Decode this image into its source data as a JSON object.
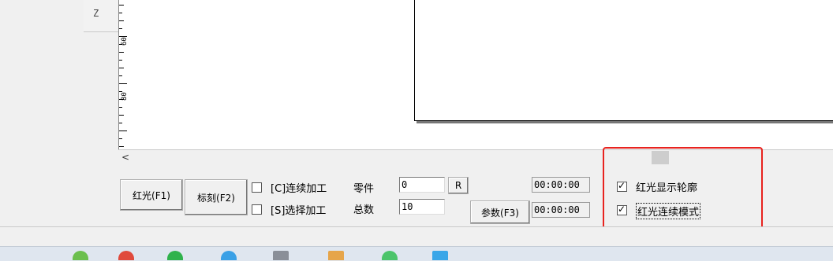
{
  "ruler": {
    "z_label": "Z",
    "marks": [
      "60",
      "80"
    ]
  },
  "buttons": {
    "red_light": "红光(F1)",
    "mark": "标刻(F2)",
    "params": "参数(F3)",
    "reset": "R"
  },
  "options": {
    "continuous": {
      "label": "[C]连续加工",
      "checked": false
    },
    "selected": {
      "label": "[S]选择加工",
      "checked": false
    }
  },
  "counters": {
    "parts_label": "零件",
    "parts_value": "0",
    "total_label": "总数",
    "total_value": "10"
  },
  "timers": {
    "time1": "00:00:00",
    "time2": "00:00:00"
  },
  "red_light_options": {
    "show_outline": {
      "label": "红光显示轮廓",
      "checked": true
    },
    "continuous_mode": {
      "label": "红光连续模式",
      "checked": true
    }
  },
  "scrollbar": {
    "left_arrow": "<"
  },
  "colors": {
    "highlight": "#e8231f",
    "panel": "#f0f0f0",
    "canvas": "#ffffff"
  }
}
